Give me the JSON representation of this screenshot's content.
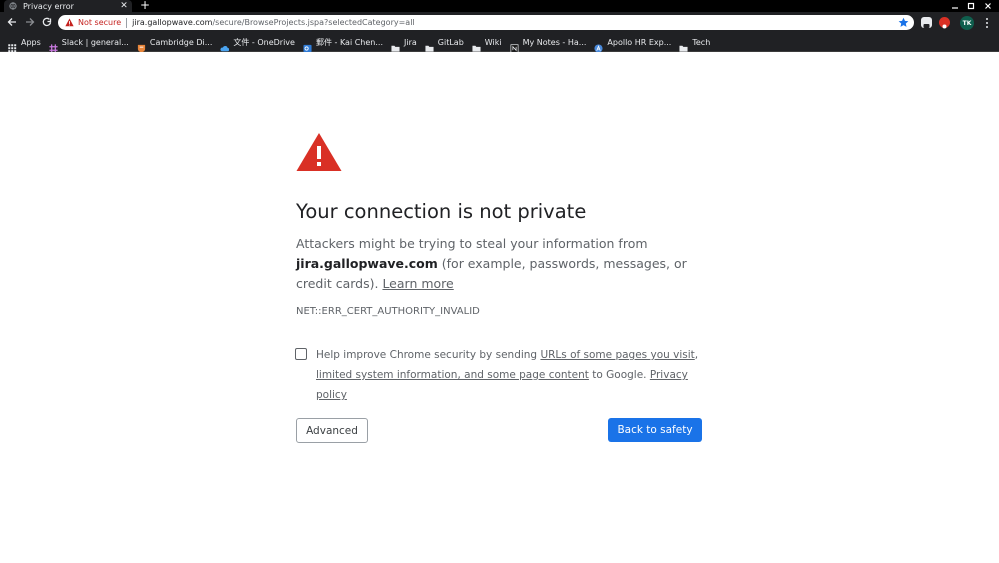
{
  "tab": {
    "title": "Privacy error"
  },
  "omnibox": {
    "security_label": "Not secure",
    "url_host": "jira.gallopwave.com",
    "url_rest": "/secure/BrowseProjects.jspa?selectedCategory=all"
  },
  "profile": {
    "initials": "TK"
  },
  "bookmarks": [
    {
      "label": "Apps",
      "icon": "apps-grid-icon",
      "color": "#e8eaed"
    },
    {
      "label": "Slack | general...",
      "icon": "slack-icon",
      "color": "#c97ae0"
    },
    {
      "label": "Cambridge Di...",
      "icon": "cambridge-icon",
      "color": "#e8853a"
    },
    {
      "label": "文件 - OneDrive",
      "icon": "onedrive-icon",
      "color": "#4aa3ef"
    },
    {
      "label": "郵件 - Kai Chen...",
      "icon": "outlook-icon",
      "color": "#2f7bd6"
    },
    {
      "label": "Jira",
      "icon": "folder-icon",
      "color": "#e8eaed"
    },
    {
      "label": "GitLab",
      "icon": "folder-icon",
      "color": "#e8eaed"
    },
    {
      "label": "Wiki",
      "icon": "folder-icon",
      "color": "#e8eaed"
    },
    {
      "label": "My Notes - Ha...",
      "icon": "notion-icon",
      "color": "#e8eaed"
    },
    {
      "label": "Apollo HR Exp...",
      "icon": "apollo-icon",
      "color": "#4a8bdd"
    },
    {
      "label": "Tech",
      "icon": "folder-icon",
      "color": "#e8eaed"
    }
  ],
  "page": {
    "heading": "Your connection is not private",
    "explanation_pre": "Attackers might be trying to steal your information from ",
    "host": "jira.gallopwave.com",
    "explanation_post": " (for example, passwords, messages, or credit cards). ",
    "learn_more": "Learn more",
    "error_code": "NET::ERR_CERT_AUTHORITY_INVALID",
    "optin_pre": "Help improve Chrome security by sending ",
    "optin_link1": "URLs of some pages you visit",
    "optin_sep": ", ",
    "optin_link2": "limited system information, and some page content",
    "optin_mid": " to Google. ",
    "optin_link3": "Privacy policy",
    "advanced_label": "Advanced",
    "back_label": "Back to safety"
  },
  "colors": {
    "warning_red": "#d93025",
    "primary_blue": "#1a73e8",
    "not_secure_red": "#c5221f"
  }
}
